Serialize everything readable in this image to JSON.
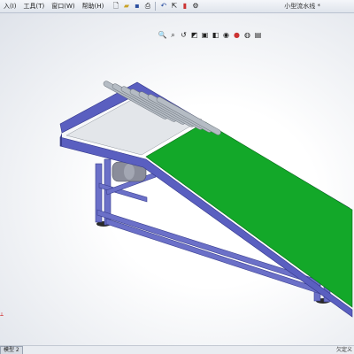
{
  "menu": {
    "insert": "入(I)",
    "tools": "工具(T)",
    "window": "窗口(W)",
    "help": "帮助(H)"
  },
  "document_title": "小型流水线 *",
  "status": {
    "tab_label": "模型 2",
    "right_text": "欠定义"
  },
  "icons": {
    "toolbar_top": [
      "new-file-icon",
      "open-icon",
      "save-icon",
      "print-icon",
      "undo-icon",
      "select-icon",
      "rebuild-icon",
      "options-icon"
    ],
    "toolbar_second": [
      "line-icon",
      "arc-icon",
      "spline-icon",
      "circle-icon",
      "point-icon",
      "smart-dimension-icon"
    ],
    "view_toolbar": [
      "zoom-fit-icon",
      "zoom-area-icon",
      "previous-view-icon",
      "section-view-icon",
      "view-orientation-icon",
      "display-style-icon",
      "hide-show-icon",
      "edit-appearance-icon",
      "scene-icon",
      "view-settings-icon"
    ]
  },
  "colors": {
    "frame": "#5a5fc0",
    "belt": "#13a829",
    "roller": "#a9b3bc"
  }
}
